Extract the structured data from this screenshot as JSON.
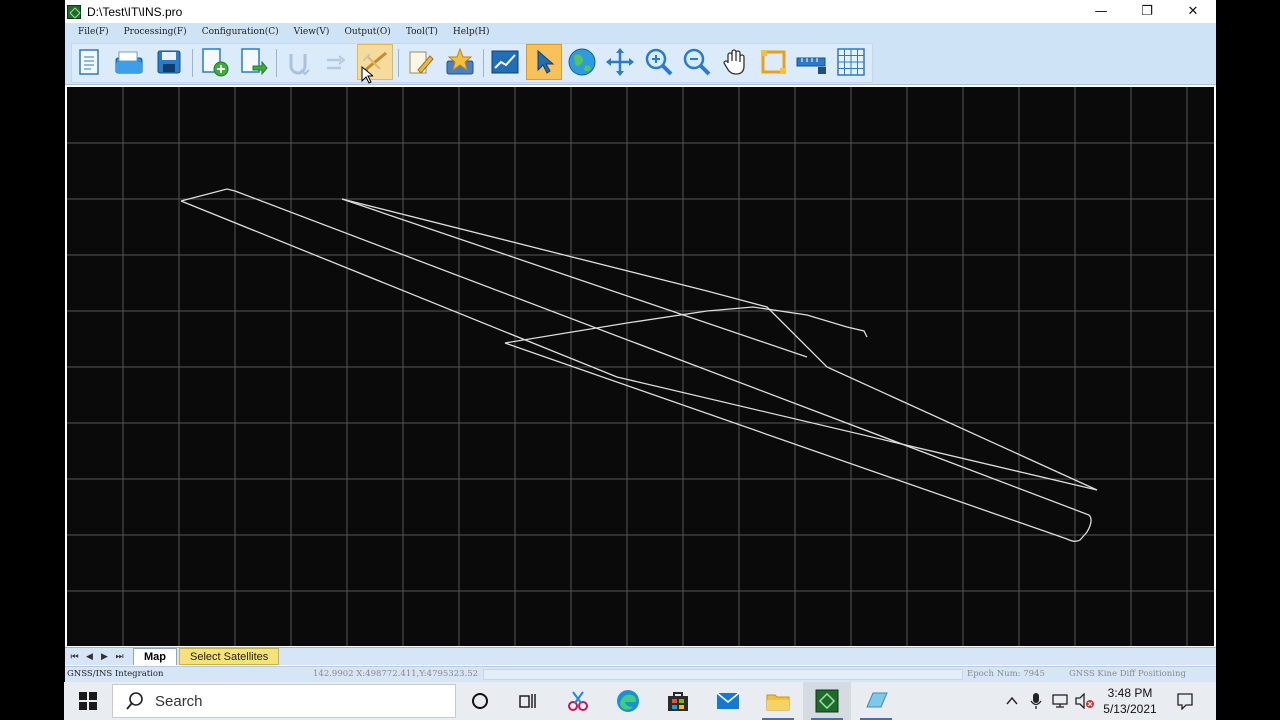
{
  "window": {
    "title": "D:\\Test\\IT\\INS.pro",
    "controls": {
      "minimize": "—",
      "maximize": "❐",
      "close": "✕"
    }
  },
  "menu": [
    "File(F)",
    "Processing(F)",
    "Configuration(C)",
    "View(V)",
    "Output(O)",
    "Tool(T)",
    "Help(H)"
  ],
  "toolbar": {
    "buttons": [
      "new-file-icon",
      "open-folder-icon",
      "save-disk-icon",
      "add-file-icon",
      "export-file-icon",
      "undo-path-icon",
      "redo-arrow-icon",
      "ins-process-icon",
      "edit-document-icon",
      "star-folder-icon",
      "chart-view-icon",
      "select-pointer-icon",
      "globe-icon",
      "move-cross-icon",
      "zoom-in-icon",
      "zoom-out-icon",
      "pan-hand-icon",
      "zoom-rectangle-icon",
      "measure-ruler-icon",
      "grid-icon"
    ],
    "active_tool": "select-pointer-icon"
  },
  "sheets": {
    "active": "Map",
    "other": "Select Satellites"
  },
  "status": {
    "mode": "GNSS/INS Integration",
    "coords": "142.9902 X:498772.411,Y:4795323.52",
    "epoch": "Epoch Num: 7945",
    "solution": "GNSS Kine Diff Positioning"
  },
  "taskbar": {
    "search_placeholder": "Search",
    "time": "3:48 PM",
    "date": "5/13/2021",
    "apps": [
      "cortana-icon",
      "task-view-icon",
      "snip-tool-icon",
      "edge-browser-icon",
      "store-icon",
      "mail-icon",
      "file-explorer-icon",
      "ins-app-icon",
      "second-app-icon"
    ]
  },
  "colors": {
    "menu_bg": "#cfe3f7",
    "canvas_bg": "#0a0a0a",
    "grid": "#5a5a5a",
    "track": "#d8d8d8",
    "active_tool_bg": "#f8c15a"
  }
}
